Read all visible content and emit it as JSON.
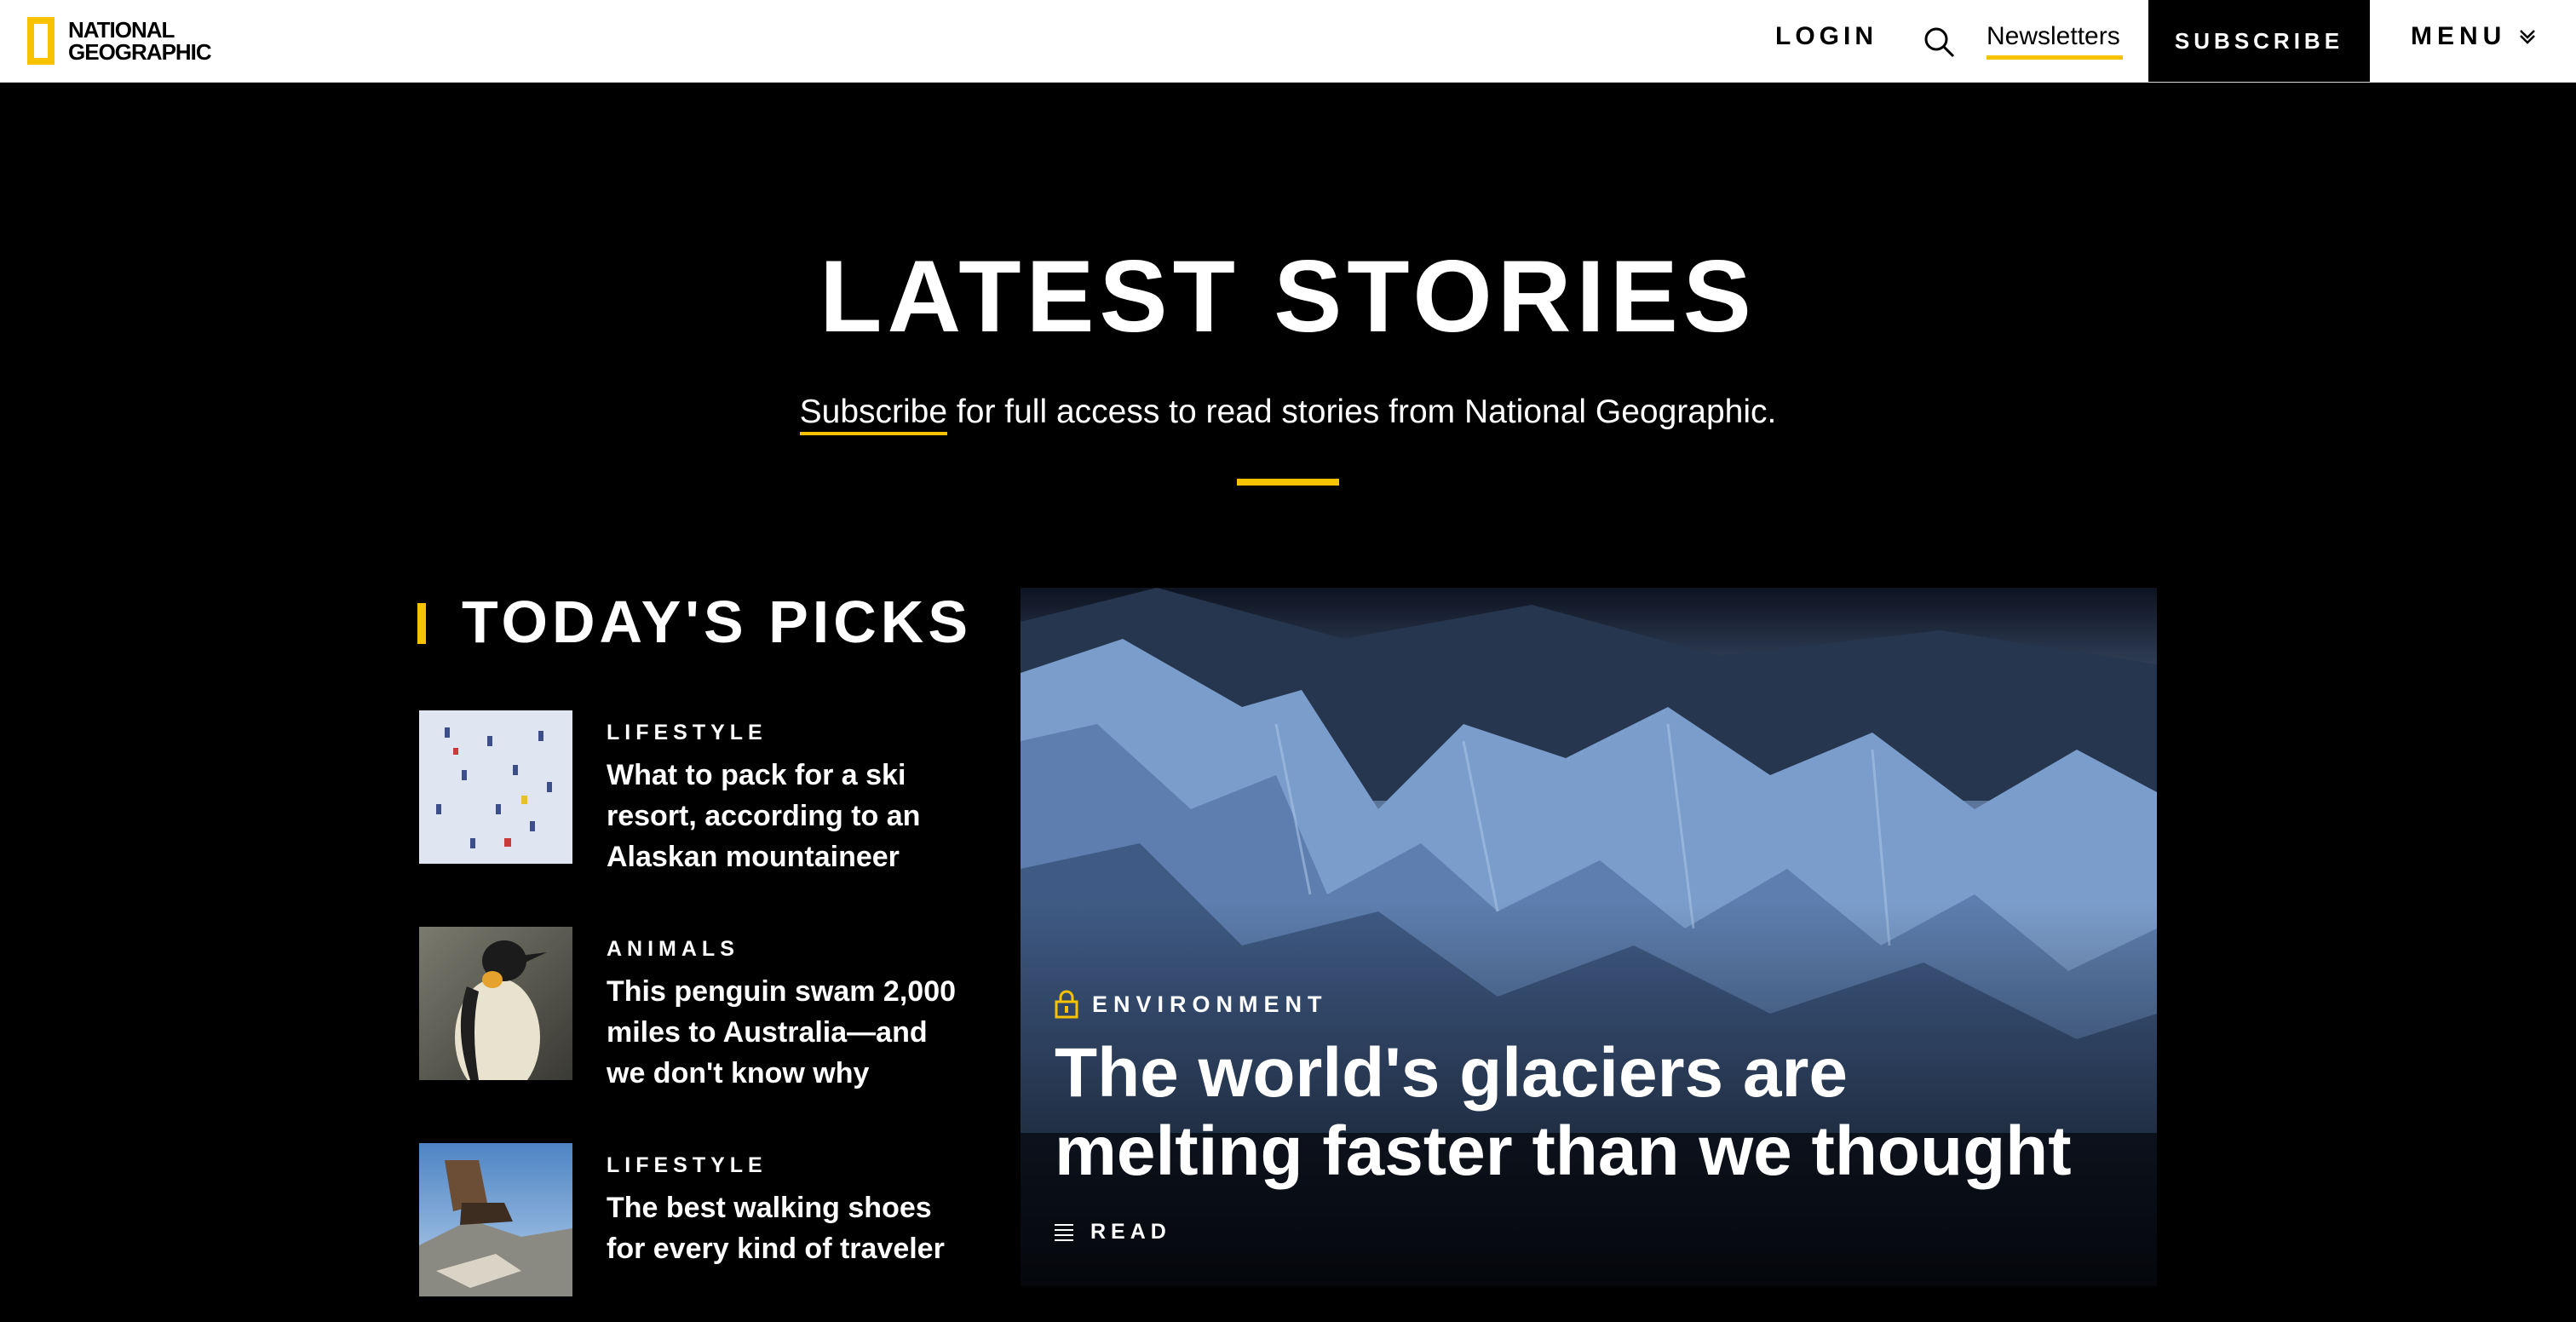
{
  "header": {
    "logo": {
      "line1": "NATIONAL",
      "line2": "GEOGRAPHIC",
      "brand_color": "#f7c300"
    },
    "login": "LOGIN",
    "search_icon": "search-icon",
    "newsletters": "Newsletters",
    "subscribe": "SUBSCRIBE",
    "menu": "MENU",
    "menu_icon": "chevron-down-icon"
  },
  "hero": {
    "title": "LATEST STORIES",
    "subscribe_link": "Subscribe",
    "subtitle_rest": " for full access to read stories from National Geographic.",
    "accent_color": "#f7c300"
  },
  "picks": {
    "title": "TODAY'S PICKS",
    "items": [
      {
        "category": "LIFESTYLE",
        "title": "What to pack for a ski resort, according to an Alaskan mountaineer",
        "thumb": "skiers-aerial-image"
      },
      {
        "category": "ANIMALS",
        "title": "This penguin swam 2,000 miles to Australia—and we don't know why",
        "thumb": "penguin-image"
      },
      {
        "category": "LIFESTYLE",
        "title": "The best walking shoes for every kind of traveler",
        "thumb": "hiking-boots-image"
      }
    ]
  },
  "feature": {
    "category": "ENVIRONMENT",
    "title": "The world's glaciers are melting faster than we thought",
    "read": "READ",
    "lock_icon": "lock-icon",
    "read_icon": "read-lines-icon"
  }
}
